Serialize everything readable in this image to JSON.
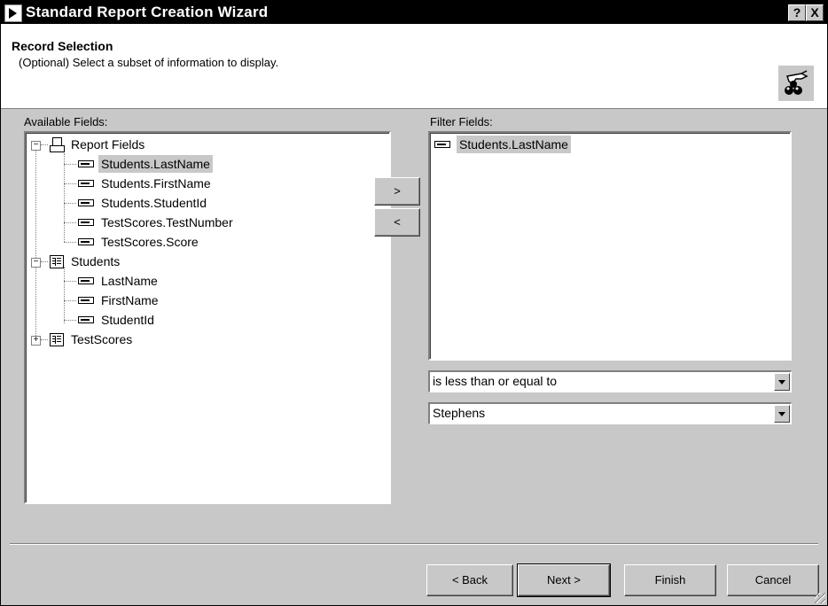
{
  "window": {
    "title": "Standard Report Creation Wizard",
    "help_button": "?",
    "close_button": "X"
  },
  "header": {
    "title": "Record Selection",
    "subtitle": "(Optional)  Select a subset of information to display."
  },
  "available_fields": {
    "label": "Available Fields:",
    "tree": [
      {
        "label": "Report Fields",
        "icon": "report-icon",
        "expander": "−"
      },
      {
        "label": "Students.LastName",
        "icon": "field-icon",
        "selected": true
      },
      {
        "label": "Students.FirstName",
        "icon": "field-icon"
      },
      {
        "label": "Students.StudentId",
        "icon": "field-icon"
      },
      {
        "label": "TestScores.TestNumber",
        "icon": "field-icon"
      },
      {
        "label": "TestScores.Score",
        "icon": "field-icon"
      },
      {
        "label": "Students",
        "icon": "table-icon",
        "expander": "−"
      },
      {
        "label": "LastName",
        "icon": "field-icon"
      },
      {
        "label": "FirstName",
        "icon": "field-icon"
      },
      {
        "label": "StudentId",
        "icon": "field-icon"
      },
      {
        "label": "TestScores",
        "icon": "table-icon",
        "expander": "+"
      }
    ]
  },
  "move_buttons": {
    "add": ">",
    "remove": "<"
  },
  "filter_fields": {
    "label": "Filter Fields:",
    "items": [
      {
        "label": "Students.LastName",
        "icon": "field-icon",
        "selected": true
      }
    ],
    "operator": "is less than or equal to",
    "value": "Stephens"
  },
  "footer": {
    "back": "< Back",
    "next": "Next >",
    "finish": "Finish",
    "cancel": "Cancel"
  }
}
